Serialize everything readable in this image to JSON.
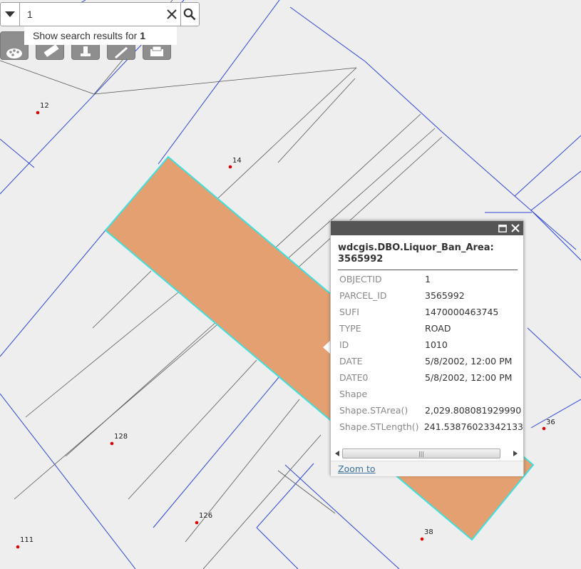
{
  "search": {
    "value": "1",
    "suggestion_prefix": "Show search results for",
    "suggestion_term": "1"
  },
  "toolbar": {
    "tools": [
      {
        "name": "basemap-gallery-button",
        "icon": "palette-icon"
      },
      {
        "name": "measure-button",
        "icon": "ruler-icon"
      },
      {
        "name": "locate-button",
        "icon": "pin-icon"
      },
      {
        "name": "draw-button",
        "icon": "pencil-icon"
      },
      {
        "name": "print-button",
        "icon": "printer-icon"
      }
    ]
  },
  "map": {
    "parcel_fill": "#e4a070",
    "parcel_outline": "#3ee0e0",
    "line_blue": "#2c45d6",
    "line_dark": "#555555",
    "point_color": "#dd0000",
    "labels": [
      {
        "text": "12"
      },
      {
        "text": "14"
      },
      {
        "text": "128"
      },
      {
        "text": "126"
      },
      {
        "text": "111"
      },
      {
        "text": "36"
      },
      {
        "text": "38"
      }
    ]
  },
  "popup": {
    "title": "wdcgis.DBO.Liquor_Ban_Area: 3565992",
    "attributes": [
      {
        "key": "OBJECTID",
        "value": "1"
      },
      {
        "key": "PARCEL_ID",
        "value": "3565992"
      },
      {
        "key": "SUFI",
        "value": "1470000463745"
      },
      {
        "key": "TYPE",
        "value": "ROAD"
      },
      {
        "key": "ID",
        "value": "1010"
      },
      {
        "key": "DATE",
        "value": "5/8/2002, 12:00 PM"
      },
      {
        "key": "DATE0",
        "value": "5/8/2002, 12:00 PM"
      },
      {
        "key": "Shape",
        "value": ""
      },
      {
        "key": "Shape.STArea()",
        "value": "2,029.808081929990"
      },
      {
        "key": "Shape.STLength()",
        "value": "241.53876023342133"
      }
    ],
    "zoom_label": "Zoom to"
  }
}
